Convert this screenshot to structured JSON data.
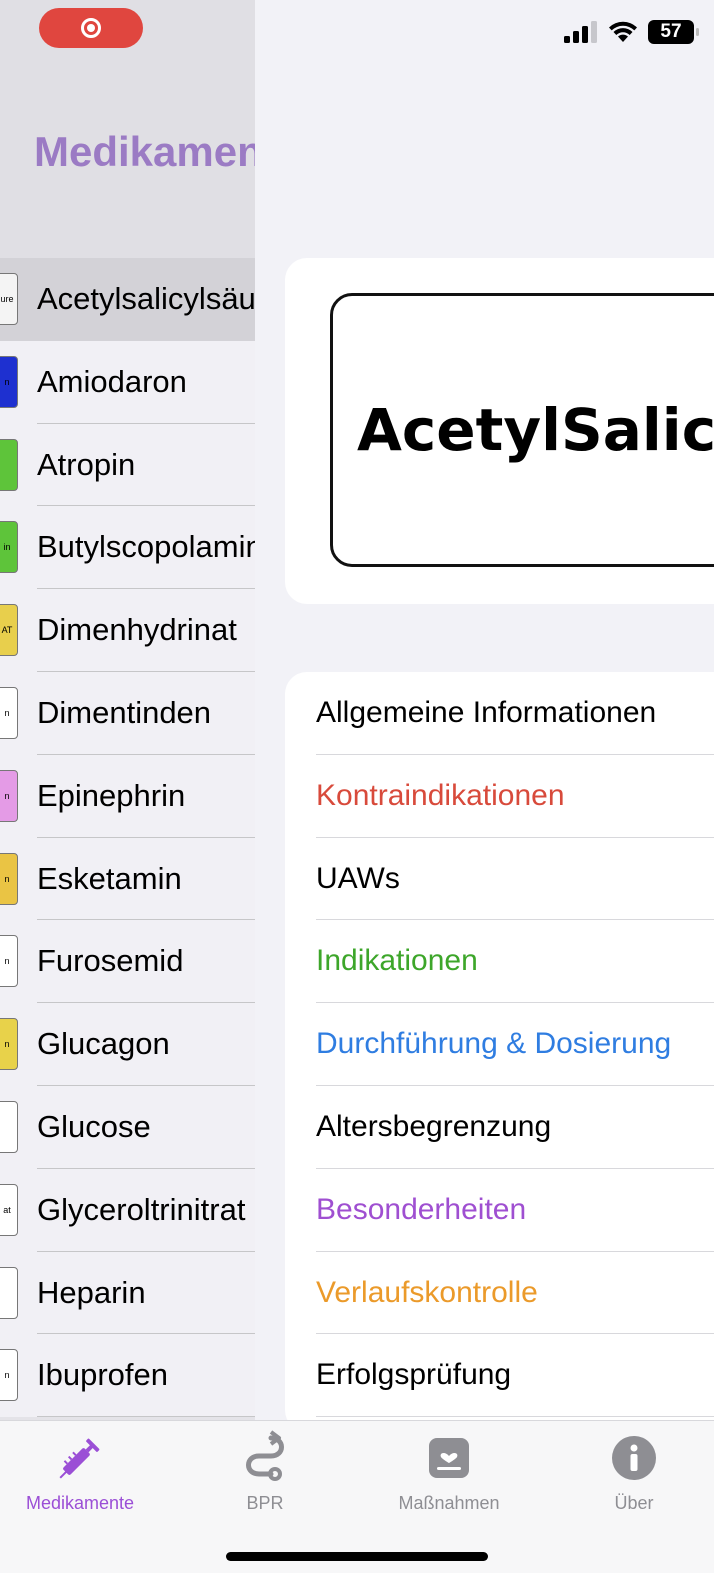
{
  "status_bar": {
    "battery": "57"
  },
  "sidebar": {
    "title": "Medikamente",
    "items": [
      {
        "label": "Acetylsalicylsäure",
        "thumb_text": "ure",
        "thumb_color": "#f4f4f4",
        "selected": true
      },
      {
        "label": "Amiodaron",
        "thumb_text": "n",
        "thumb_color": "#1e30d0"
      },
      {
        "label": "Atropin",
        "thumb_text": "",
        "thumb_color": "#5ec43a"
      },
      {
        "label": "Butylscopolamin",
        "thumb_text": "in",
        "thumb_color": "#5ec43a"
      },
      {
        "label": "Dimenhydrinat",
        "thumb_text": "AT",
        "thumb_color": "#e8cf4c"
      },
      {
        "label": "Dimentinden",
        "thumb_text": "n",
        "thumb_color": "#ffffff"
      },
      {
        "label": "Epinephrin",
        "thumb_text": "n",
        "thumb_color": "#e49be6"
      },
      {
        "label": "Esketamin",
        "thumb_text": "n",
        "thumb_color": "#eac444"
      },
      {
        "label": "Furosemid",
        "thumb_text": "n",
        "thumb_color": "#ffffff"
      },
      {
        "label": "Glucagon",
        "thumb_text": "n",
        "thumb_color": "#e8d24a"
      },
      {
        "label": "Glucose",
        "thumb_text": "",
        "thumb_color": "#ffffff"
      },
      {
        "label": "Glyceroltrinitrat",
        "thumb_text": "at",
        "thumb_color": "#ffffff"
      },
      {
        "label": "Heparin",
        "thumb_text": "",
        "thumb_color": "#ffffff"
      },
      {
        "label": "Ibuprofen",
        "thumb_text": "n",
        "thumb_color": "#ffffff"
      }
    ]
  },
  "detail": {
    "drug_label": "AcetylSalicylsäure",
    "sections": [
      {
        "label": "Allgemeine Informationen",
        "color": "#000000"
      },
      {
        "label": "Kontraindikationen",
        "color": "#d84a3b"
      },
      {
        "label": "UAWs",
        "color": "#000000"
      },
      {
        "label": "Indikationen",
        "color": "#3da62a"
      },
      {
        "label": "Durchführung & Dosierung",
        "color": "#2f7de1"
      },
      {
        "label": "Altersbegrenzung",
        "color": "#000000"
      },
      {
        "label": "Besonderheiten",
        "color": "#9f4fd1"
      },
      {
        "label": "Verlaufskontrolle",
        "color": "#eb9a2a"
      },
      {
        "label": "Erfolgsprüfung",
        "color": "#000000"
      }
    ]
  },
  "tabbar": {
    "tabs": [
      {
        "label": "Medikamente",
        "icon": "syringe-icon",
        "active": true
      },
      {
        "label": "BPR",
        "icon": "route-icon",
        "active": false
      },
      {
        "label": "Maßnahmen",
        "icon": "heart-clipboard-icon",
        "active": false
      },
      {
        "label": "Über",
        "icon": "info-icon",
        "active": false
      }
    ],
    "active_color": "#9b4fd6",
    "inactive_color": "#8e8e93"
  }
}
